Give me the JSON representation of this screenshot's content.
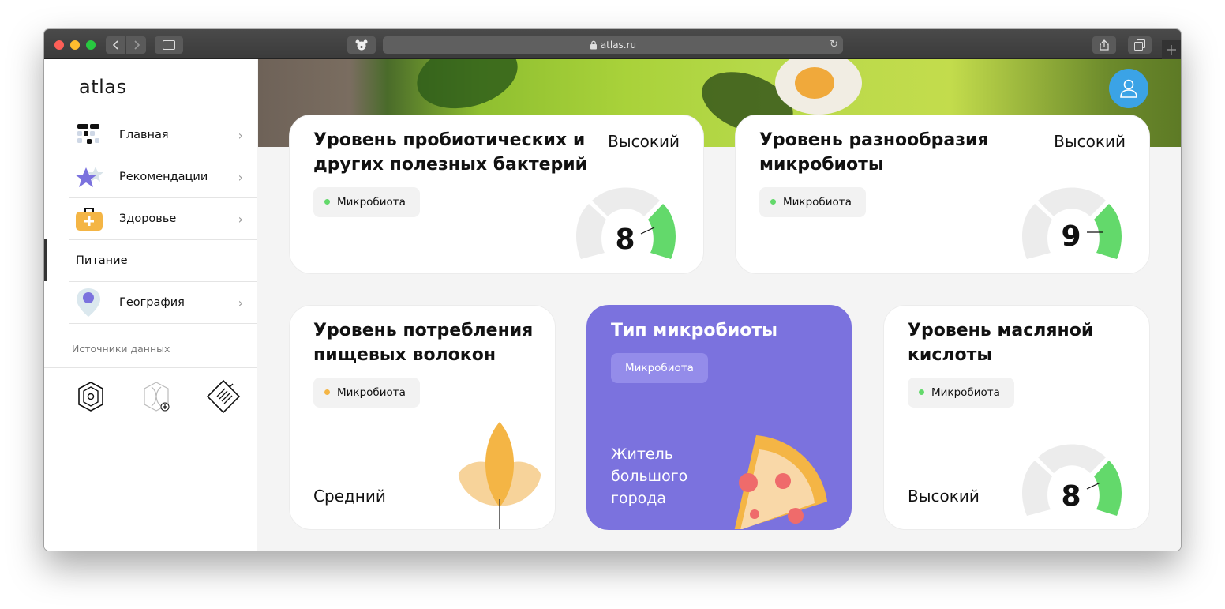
{
  "browser": {
    "url": "atlas.ru",
    "lock_icon": "lock-icon",
    "back_icon": "chevron-left-icon",
    "forward_icon": "chevron-right-icon"
  },
  "sidebar": {
    "logo": "atlas",
    "items": [
      {
        "label": "Главная",
        "icon": "home-icon"
      },
      {
        "label": "Рекомендации",
        "icon": "star-icon"
      },
      {
        "label": "Здоровье",
        "icon": "first-aid-icon"
      },
      {
        "label": "Питание",
        "icon": ""
      },
      {
        "label": "География",
        "icon": "location-pin-icon"
      }
    ],
    "sources_title": "Источники данных",
    "sources": [
      "microbiome-kit-icon",
      "dna-add-icon",
      "lab-report-icon"
    ]
  },
  "main": {
    "profile_icon": "user-icon",
    "cards": {
      "probiotic": {
        "title_line1": "Уровень пробиотических и",
        "title_line2": "других полезных бактерий",
        "level": "Высокий",
        "tag": "Микробиота",
        "score": "8"
      },
      "diversity": {
        "title_line1": "Уровень разнообразия",
        "title_line2": "микробиоты",
        "level": "Высокий",
        "tag": "Микробиота",
        "score": "9"
      },
      "fiber": {
        "title_line1": "Уровень потребления",
        "title_line2": "пищевых волокон",
        "level": "Средний",
        "tag": "Микробиота"
      },
      "type": {
        "title": "Тип микробиоты",
        "tag": "Микробиота",
        "result_line1": "Житель",
        "result_line2": "большого",
        "result_line3": "города"
      },
      "butyric": {
        "title_line1": "Уровень масляной",
        "title_line2": "кислоты",
        "level": "Высокий",
        "tag": "Микробиота",
        "score": "8"
      }
    }
  },
  "colors": {
    "accent_green": "#63d96b",
    "accent_orange": "#f4b545",
    "purple": "#7b72de",
    "avatar_blue": "#3ba3e6"
  }
}
